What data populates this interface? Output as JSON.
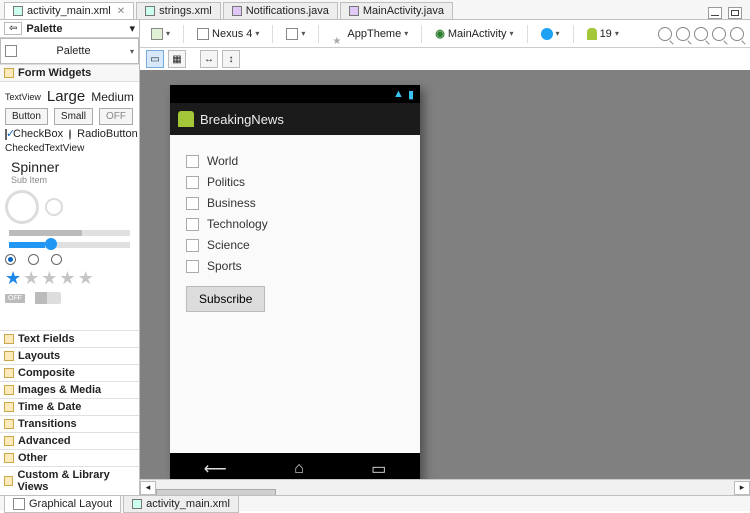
{
  "tabs": {
    "t0": "activity_main.xml",
    "t1": "strings.xml",
    "t2": "Notifications.java",
    "t3": "MainActivity.java"
  },
  "palette": {
    "title": "Palette",
    "section": "Form Widgets",
    "textview": "TextView",
    "large": "Large",
    "medium": "Medium",
    "smalltxt": "Small",
    "btn": "Button",
    "small": "Small",
    "off": "OFF",
    "checkbox": "CheckBox",
    "radiobtn": "RadioButton",
    "ctv": "CheckedTextView",
    "spinner": "Spinner",
    "subitem": "Sub Item",
    "offlabel": "OFF",
    "cats": {
      "c0": "Text Fields",
      "c1": "Layouts",
      "c2": "Composite",
      "c3": "Images & Media",
      "c4": "Time & Date",
      "c5": "Transitions",
      "c6": "Advanced",
      "c7": "Other",
      "c8": "Custom & Library Views"
    }
  },
  "toolbar": {
    "device": "Nexus 4",
    "theme": "AppTheme",
    "activity": "MainActivity",
    "api": "19"
  },
  "phone": {
    "app_title": "BreakingNews",
    "topics": {
      "t0": "World",
      "t1": "Politics",
      "t2": "Business",
      "t3": "Technology",
      "t4": "Science",
      "t5": "Sports"
    },
    "subscribe": "Subscribe"
  },
  "bottom": {
    "b0": "Graphical Layout",
    "b1": "activity_main.xml"
  }
}
